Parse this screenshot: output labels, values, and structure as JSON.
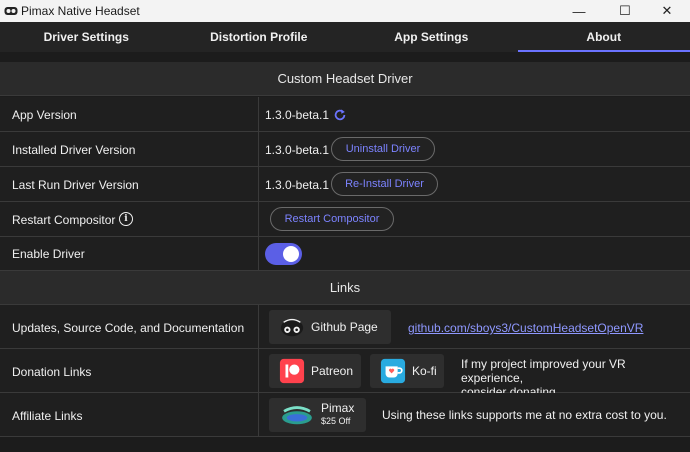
{
  "window": {
    "title": "Pimax Native Headset",
    "minimize_glyph": "—",
    "maximize_glyph": "☐",
    "close_glyph": "✕"
  },
  "tabs": [
    {
      "label": "Driver Settings",
      "active": false
    },
    {
      "label": "Distortion Profile",
      "active": false
    },
    {
      "label": "App Settings",
      "active": false
    },
    {
      "label": "About",
      "active": true
    }
  ],
  "custom_driver": {
    "header": "Custom Headset Driver",
    "app_version": {
      "label": "App Version",
      "value": "1.3.0-beta.1",
      "icon": "refresh-icon"
    },
    "installed_driver": {
      "label": "Installed Driver Version",
      "value": "1.3.0-beta.1",
      "button": "Uninstall Driver"
    },
    "last_run_driver": {
      "label": "Last Run Driver Version",
      "value": "1.3.0-beta.1",
      "button": "Re-Install Driver"
    },
    "restart_compositor": {
      "label": "Restart Compositor",
      "icon": "info-icon",
      "info_glyph": "i",
      "button": "Restart Compositor"
    },
    "enable_driver": {
      "label": "Enable Driver",
      "enabled": true
    }
  },
  "links": {
    "header": "Links",
    "updates": {
      "label": "Updates, Source Code, and Documentation",
      "github_button": "Github Page",
      "github_icon": "github-icon",
      "url_text": "github.com/sboys3/CustomHeadsetOpenVR"
    },
    "donation": {
      "label": "Donation Links",
      "patreon_button": "Patreon",
      "patreon_icon": "patreon-icon",
      "kofi_button": "Ko-fi",
      "kofi_icon": "kofi-icon",
      "note_line1": "If my project improved your VR experience,",
      "note_line2": "consider donating."
    },
    "affiliate": {
      "label": "Affiliate Links",
      "pimax_button": "Pimax",
      "pimax_sub": "$25 Off",
      "pimax_icon": "pimax-icon",
      "note": "Using these links supports me at no extra cost to you."
    }
  },
  "colors": {
    "accent": "#5b5fe6",
    "link": "#8f98ff",
    "background": "#1c1c1c",
    "patreon": "#ff424d",
    "kofi": "#29abe0"
  }
}
